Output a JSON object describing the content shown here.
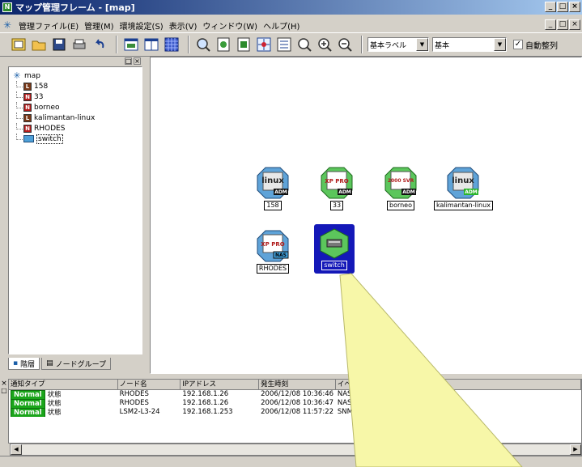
{
  "window": {
    "title": "マップ管理フレーム - [map]",
    "buttons": [
      "_",
      "□",
      "×"
    ]
  },
  "menu": {
    "items": [
      "管理ファイル(E)",
      "管理(M)",
      "環境設定(S)",
      "表示(V)",
      "ウィンドウ(W)",
      "ヘルプ(H)"
    ],
    "mdi_buttons": [
      "_",
      "□",
      "×"
    ]
  },
  "toolbar": {
    "label_combo": "基本ラベル",
    "style_combo": "基本",
    "auto_arrange_label": "自動整列",
    "auto_arrange_checked": true
  },
  "tree": {
    "pane_buttons": [
      "□",
      "×"
    ],
    "root": "map",
    "items": [
      {
        "label": "158",
        "icon": "linux-node-icon"
      },
      {
        "label": "33",
        "icon": "windows-node-icon"
      },
      {
        "label": "borneo",
        "icon": "windows-node-icon"
      },
      {
        "label": "kalimantan-linux",
        "icon": "linux-node-icon"
      },
      {
        "label": "RHODES",
        "icon": "windows-node-icon"
      },
      {
        "label": "switch",
        "icon": "switch-icon"
      }
    ],
    "tabs": [
      "階層",
      "ノードグループ"
    ]
  },
  "map": {
    "nodes": [
      {
        "label": "158",
        "os_text": "linux",
        "sub": "ADM"
      },
      {
        "label": "33",
        "os_text": "XP PRO",
        "sub": "ADM"
      },
      {
        "label": "borneo",
        "os_text": "2000 SVR",
        "sub": "ADM"
      },
      {
        "label": "kalimantan-linux",
        "os_text": "linux",
        "sub": "ADM"
      },
      {
        "label": "RHODES",
        "os_text": "XP PRO",
        "sub": "NAS"
      },
      {
        "label": "switch",
        "os_text": "",
        "sub": ""
      }
    ]
  },
  "log": {
    "columns": [
      "通知タイプ",
      "ノード名",
      "IPアドレス",
      "発生時刻",
      "イベ"
    ],
    "rows": [
      {
        "badge": "Normal",
        "type": "状態",
        "node": "RHODES",
        "ip": "192.168.1.26",
        "time": "2006/12/08 10:36:46",
        "event": "NAS"
      },
      {
        "badge": "Normal",
        "type": "状態",
        "node": "RHODES",
        "ip": "192.168.1.26",
        "time": "2006/12/08 10:36:47",
        "event": "NAS"
      },
      {
        "badge": "Normal",
        "type": "状態",
        "node": "LSM2-L3-24",
        "ip": "192.168.1.253",
        "time": "2006/12/08 11:57:22",
        "event": "SNM"
      }
    ]
  },
  "colors": {
    "titlebar": "#0a246a",
    "normal_badge": "#1aa51a",
    "selection": "#1418b8",
    "spotlight": "#f7f7a8"
  }
}
